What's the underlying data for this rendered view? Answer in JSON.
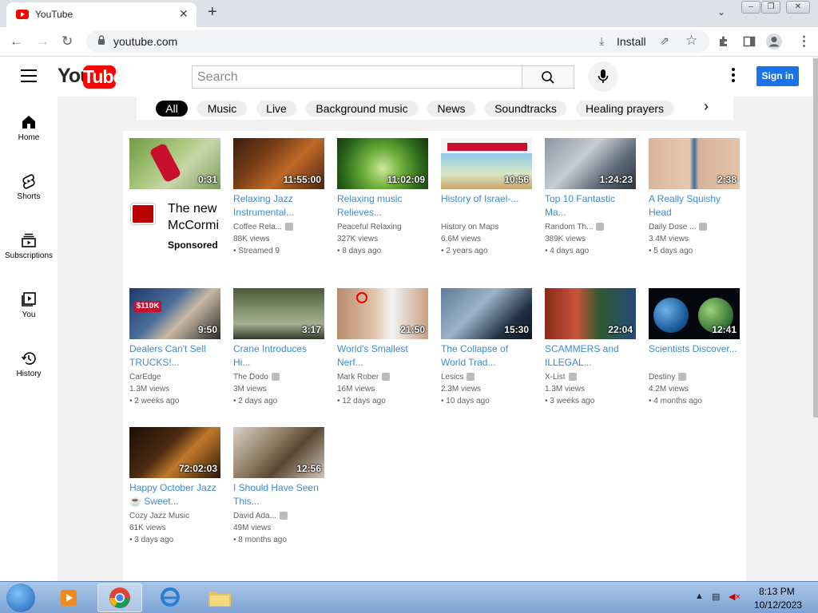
{
  "browser": {
    "tab_title": "YouTube",
    "url": "youtube.com",
    "install_label": "Install",
    "new_tab_symbol": "+",
    "close_symbol": "✕"
  },
  "header": {
    "logo_you": "You",
    "logo_tube": "Tube",
    "search_placeholder": "Search",
    "sign_in": "Sign in",
    "brand_color": "#ff0000"
  },
  "sidebar": {
    "items": [
      {
        "label": "Home",
        "icon": "home-icon"
      },
      {
        "label": "Shorts",
        "icon": "shorts-icon"
      },
      {
        "label": "Subscriptions",
        "icon": "subscriptions-icon"
      },
      {
        "label": "You",
        "icon": "library-icon"
      },
      {
        "label": "History",
        "icon": "history-icon"
      }
    ]
  },
  "chips": [
    "All",
    "Music",
    "Live",
    "Background music",
    "News",
    "Soundtracks",
    "Healing prayers"
  ],
  "ad": {
    "duration": "0:31",
    "title": "The new McCormi",
    "sponsored": "Sponsored"
  },
  "videos": [
    {
      "title": "Relaxing Jazz Instrumental...",
      "channel": "Coffee Rela...",
      "views": "88K views",
      "age": "Streamed 9",
      "duration": "11:55:00"
    },
    {
      "title": "Relaxing music Relieves...",
      "channel": "Peaceful Relaxing",
      "views": "327K views",
      "age": "8 days ago",
      "duration": "11:02:09"
    },
    {
      "title": "History of Israel-...",
      "channel": "History on Maps",
      "views": "6.6M views",
      "age": "2 years ago",
      "duration": "10:56"
    },
    {
      "title": "Top 10 Fantastic Ma...",
      "channel": "Random Th...",
      "views": "389K views",
      "age": "4 days ago",
      "duration": "1:24:23"
    },
    {
      "title": "A Really Squishy Head",
      "channel": "Daily Dose ...",
      "views": "3.4M views",
      "age": "5 days ago",
      "duration": "2:38"
    },
    {
      "title": "Dealers Can't Sell TRUCKS!...",
      "channel": "CarEdge",
      "views": "1.3M views",
      "age": "2 weeks ago",
      "duration": "9:50"
    },
    {
      "title": "Crane Introduces Hi...",
      "channel": "The Dodo",
      "views": "3M views",
      "age": "2 days ago",
      "duration": "3:17"
    },
    {
      "title": "World's Smallest Nerf...",
      "channel": "Mark Rober",
      "views": "16M views",
      "age": "12 days ago",
      "duration": "21:50"
    },
    {
      "title": "The Collapse of World Trad...",
      "channel": "Lesics",
      "views": "2.3M views",
      "age": "10 days ago",
      "duration": "15:30"
    },
    {
      "title": "SCAMMERS and ILLEGAL...",
      "channel": "X-List",
      "views": "1.3M views",
      "age": "3 weeks ago",
      "duration": "22:04"
    },
    {
      "title": "Scientists Discover...",
      "channel": "Destiny",
      "views": "4.2M views",
      "age": "4 months ago",
      "duration": "12:41"
    },
    {
      "title": "Happy October Jazz ☕ Sweet...",
      "channel": "Cozy Jazz Music",
      "views": "61K views",
      "age": "3 days ago",
      "duration": "72:02:03"
    },
    {
      "title": "I Should Have Seen This...",
      "channel": "David Ada...",
      "views": "49M views",
      "age": "8 months ago",
      "duration": "12:56"
    }
  ],
  "taskbar": {
    "time": "8:13 PM",
    "date": "10/12/2023"
  }
}
